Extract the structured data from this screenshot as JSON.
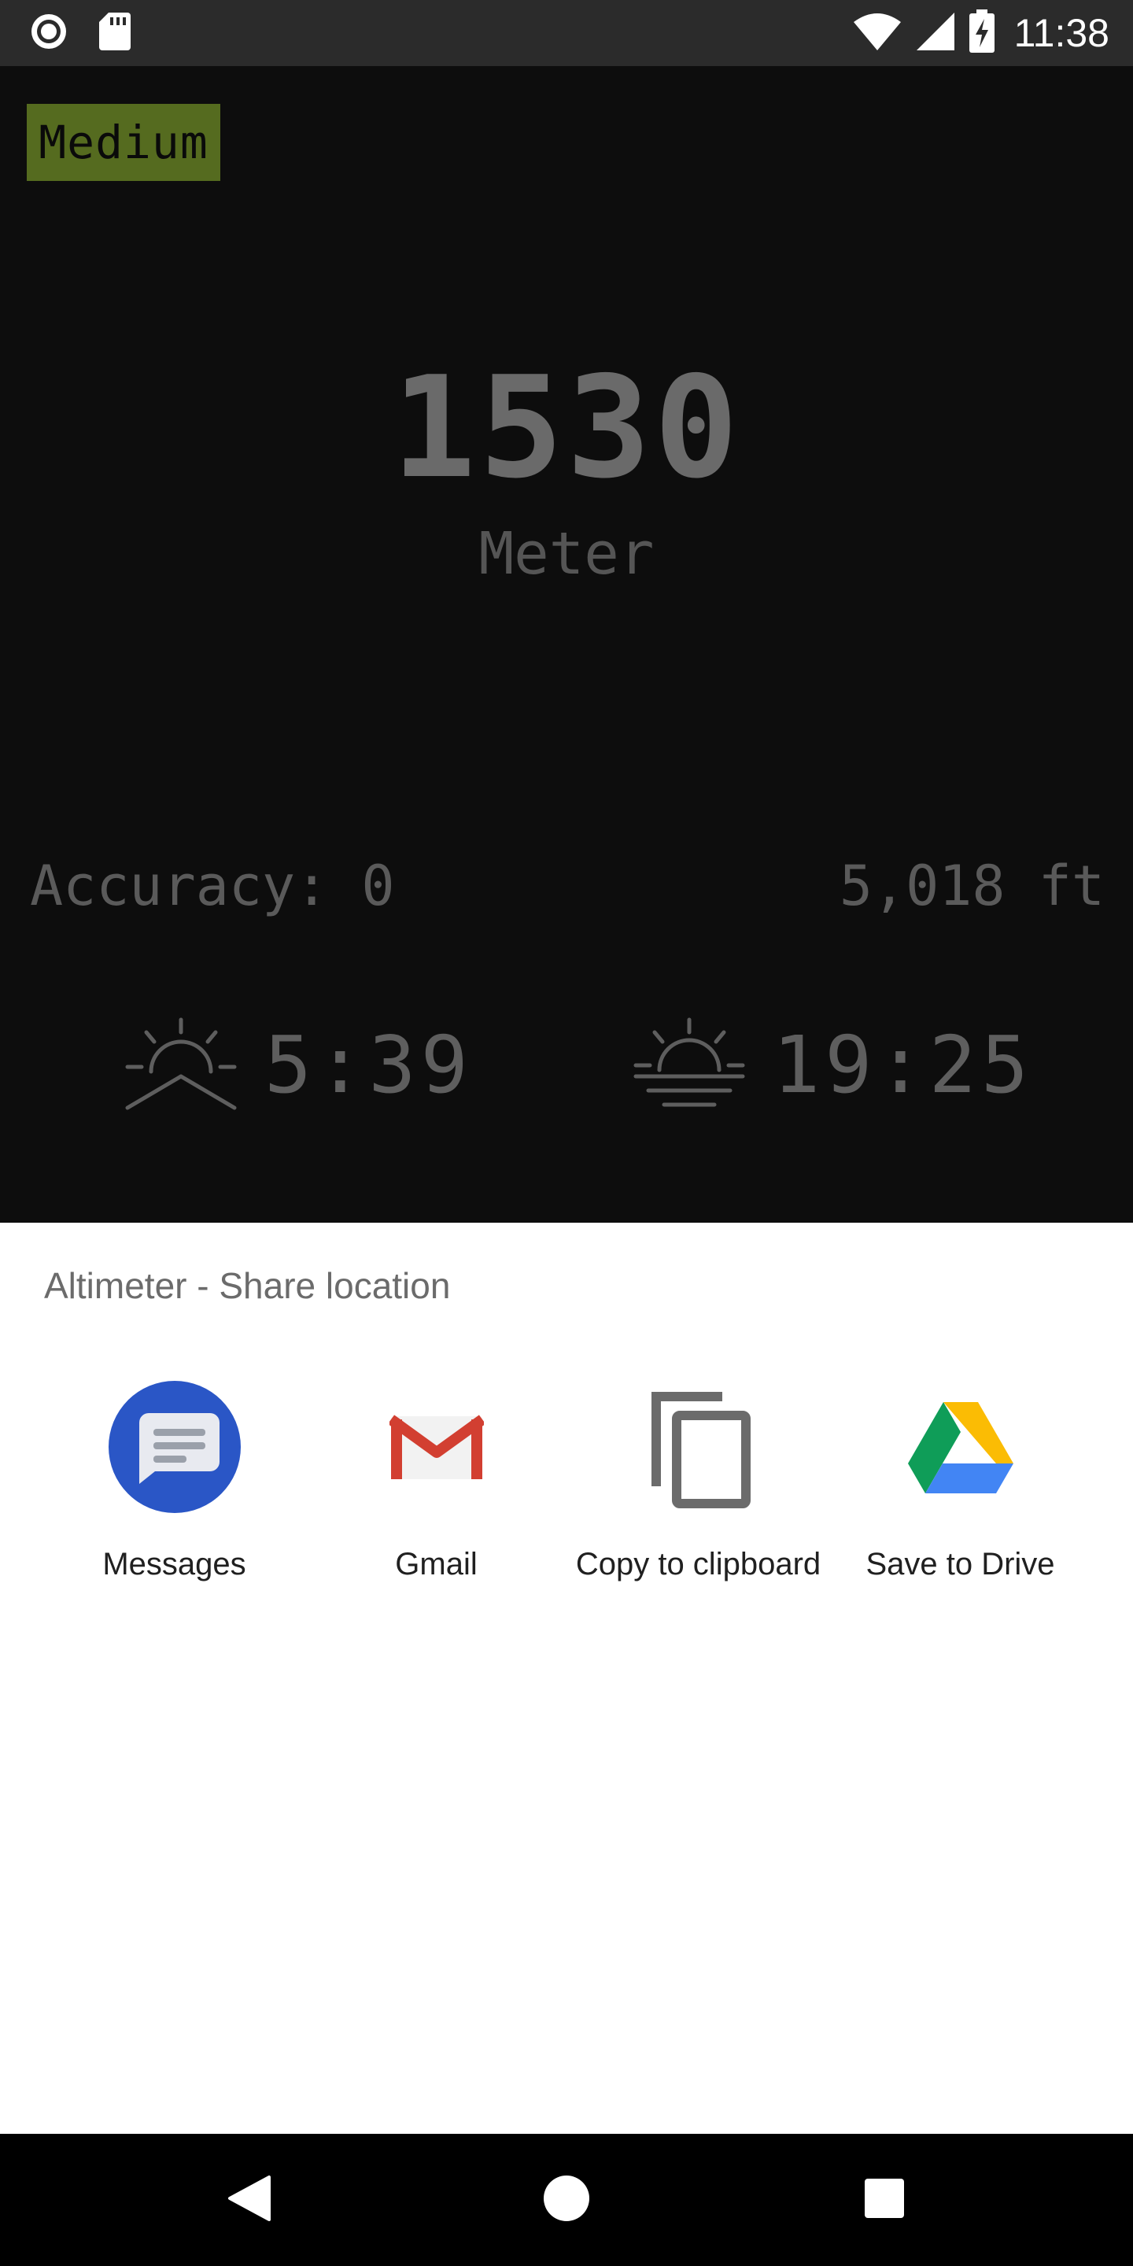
{
  "status_bar": {
    "time": "11:38",
    "left_icons": [
      "record-icon",
      "sd-card-icon"
    ],
    "right_icons": [
      "wifi-icon",
      "cell-signal-icon",
      "battery-charging-icon"
    ]
  },
  "app": {
    "accuracy_badge": "Medium",
    "altitude_value": "1530",
    "altitude_unit": "Meter",
    "accuracy_text": "Accuracy: 0",
    "feet_text": "5,018 ft",
    "sunrise": {
      "icon": "sunrise-icon",
      "time": "5:39"
    },
    "sunset": {
      "icon": "sunset-icon",
      "time": "19:25"
    },
    "badge_color": "#556b1f"
  },
  "share_sheet": {
    "title": "Altimeter - Share location",
    "targets": [
      {
        "label": "Messages",
        "icon": "messages-icon"
      },
      {
        "label": "Gmail",
        "icon": "gmail-icon"
      },
      {
        "label": "Copy to clipboard",
        "icon": "clipboard-icon"
      },
      {
        "label": "Save to Drive",
        "icon": "drive-icon"
      }
    ]
  },
  "nav_bar": {
    "buttons": [
      "back-icon",
      "home-icon",
      "recents-icon"
    ]
  }
}
